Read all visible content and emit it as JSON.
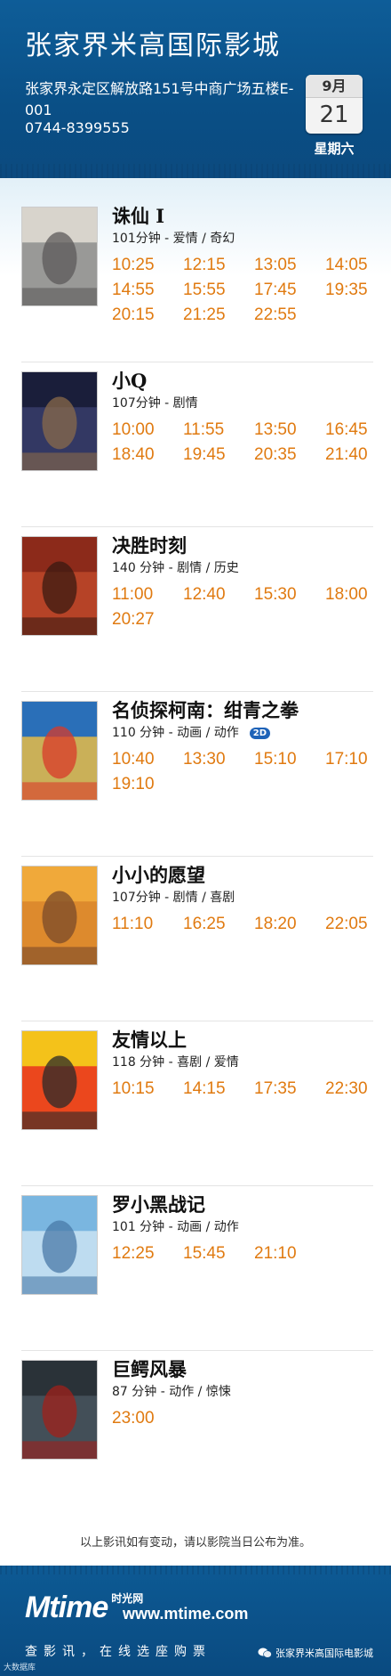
{
  "header": {
    "cinema_name": "张家界米高国际影城",
    "address": "张家界永定区解放路151号中商广场五楼E-001",
    "phone": "0744-8399555",
    "date_month": "9月",
    "date_day": "21",
    "weekday": "星期六"
  },
  "films": [
    {
      "title": "诛仙 I",
      "meta": "101分钟 - 爱情 / 奇幻",
      "times": [
        "10:25",
        "12:15",
        "13:05",
        "14:05",
        "14:55",
        "15:55",
        "17:45",
        "19:35",
        "20:15",
        "21:25",
        "22:55"
      ],
      "poster_colors": [
        "#d8d4cc",
        "#8a8a8a",
        "#5c5a5a"
      ]
    },
    {
      "title": "小Q",
      "meta": "107分钟 - 剧情",
      "times": [
        "10:00",
        "11:55",
        "13:50",
        "16:45",
        "18:40",
        "19:45",
        "20:35",
        "21:40"
      ],
      "poster_colors": [
        "#1a1e3a",
        "#3a3f6e",
        "#8a6a4a"
      ]
    },
    {
      "title": "决胜时刻",
      "meta": "140 分钟 - 剧情 / 历史",
      "times": [
        "11:00",
        "12:40",
        "15:30",
        "18:00",
        "20:27"
      ],
      "poster_colors": [
        "#8c2a1a",
        "#c04a2a",
        "#3a1a12"
      ]
    },
    {
      "title": "名侦探柯南：绀青之拳",
      "meta": "110 分钟 - 动画 / 动作",
      "badge": "2D",
      "times": [
        "10:40",
        "13:30",
        "15:10",
        "17:10",
        "19:10"
      ],
      "poster_colors": [
        "#2a6fb8",
        "#f2c040",
        "#d83a2a"
      ]
    },
    {
      "title": "小小的愿望",
      "meta": "107分钟 - 剧情 / 喜剧",
      "times": [
        "11:10",
        "16:25",
        "18:20",
        "22:05"
      ],
      "poster_colors": [
        "#f0a93a",
        "#d8822a",
        "#7a4a2a"
      ]
    },
    {
      "title": "友情以上",
      "meta": "118 分钟 - 喜剧 / 爱情",
      "times": [
        "10:15",
        "14:15",
        "17:35",
        "22:30"
      ],
      "poster_colors": [
        "#f4c21a",
        "#e8281e",
        "#2a2a2a"
      ]
    },
    {
      "title": "罗小黑战记",
      "meta": "101 分钟 - 动画 / 动作",
      "times": [
        "12:25",
        "15:45",
        "21:10"
      ],
      "poster_colors": [
        "#7ab6e0",
        "#cfe6f4",
        "#4a7aa8"
      ]
    },
    {
      "title": "巨鳄风暴",
      "meta": "87 分钟 - 动作 / 惊悚",
      "times": [
        "23:00"
      ],
      "poster_colors": [
        "#2a3238",
        "#4a5660",
        "#a0201a"
      ]
    }
  ],
  "notice": "以上影讯如有变动，请以影院当日公布为准。",
  "footer": {
    "logo_text": "Mtime",
    "logo_cn": "时光网",
    "url": "www.mtime.com",
    "slogan": "查影讯，在线选座购票",
    "account_name": "张家界米高国际电影城",
    "watermark": "大数据库"
  },
  "colors": {
    "header_bg": "#0e5d98",
    "showtime": "#e07a10",
    "badge_2d": "#1e63b8"
  }
}
